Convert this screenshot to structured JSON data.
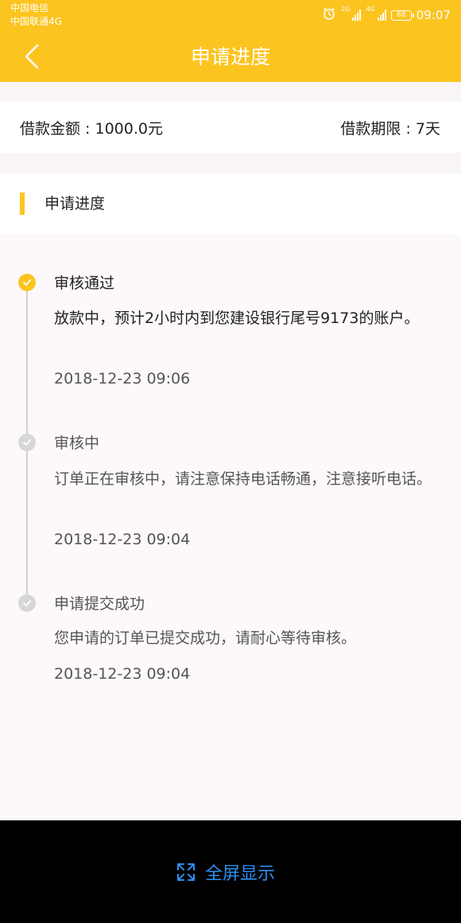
{
  "status_bar": {
    "carrier1": "中国电信",
    "carrier2": "中国联通4G",
    "net1": "2G",
    "net2": "4G",
    "battery": "88",
    "time": "09:07"
  },
  "header": {
    "title": "申请进度",
    "background": "#fcc41f"
  },
  "loan": {
    "amount": "借款金额 : 1000.0元",
    "term": "借款期限 : 7天"
  },
  "section": {
    "title": "申请进度"
  },
  "steps": [
    {
      "title": "审核通过",
      "desc": "放款中，预计2小时内到您建设银行尾号9173的账户。",
      "time": "2018-12-23 09:06",
      "state": "active"
    },
    {
      "title": "审核中",
      "desc": "订单正在审核中，请注意保持电话畅通，注意接听电话。",
      "time": "2018-12-23 09:04",
      "state": "inactive"
    },
    {
      "title": "申请提交成功",
      "desc": "您申请的订单已提交成功，请耐心等待审核。",
      "time": "2018-12-23 09:04",
      "state": "inactive"
    }
  ],
  "bottom": {
    "fullscreen_label": "全屏显示",
    "accent": "#2e8ef0"
  }
}
